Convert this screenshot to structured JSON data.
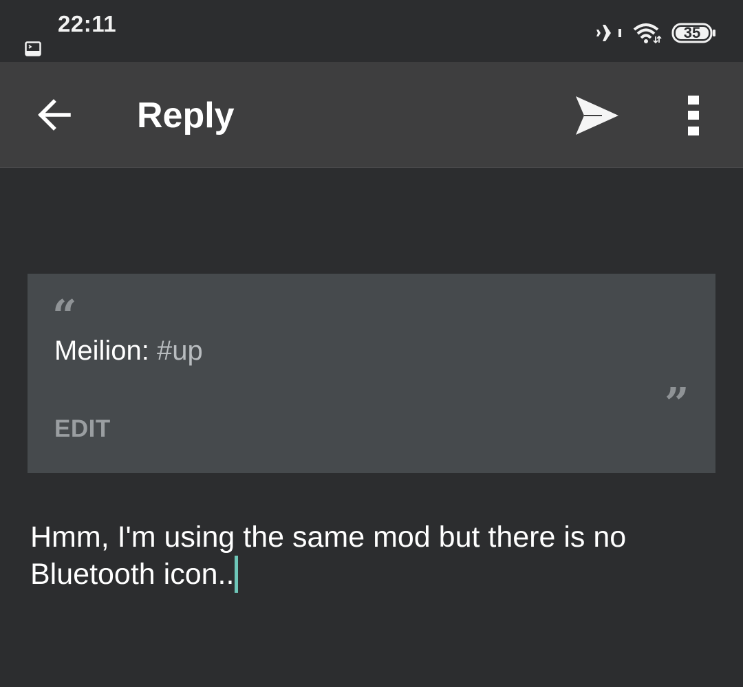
{
  "status_bar": {
    "time": "22:11",
    "battery_level": "35",
    "icons": [
      "terminal-notification-icon",
      "airplane-mode-icon",
      "wifi-icon",
      "battery-icon"
    ]
  },
  "app_bar": {
    "title": "Reply",
    "icons": [
      "back-arrow-icon",
      "send-icon",
      "more-vert-icon"
    ]
  },
  "quote": {
    "author": "Meilion:",
    "text": "#up",
    "edit_label": "EDIT"
  },
  "reply": {
    "value": "Hmm, I'm using the same mod but there is no Bluetooth icon.."
  },
  "colors": {
    "background": "#2c2d2f",
    "app_bar": "#3e3e3f",
    "quote_card": "#464a4d",
    "caret": "#6ec6b8"
  }
}
